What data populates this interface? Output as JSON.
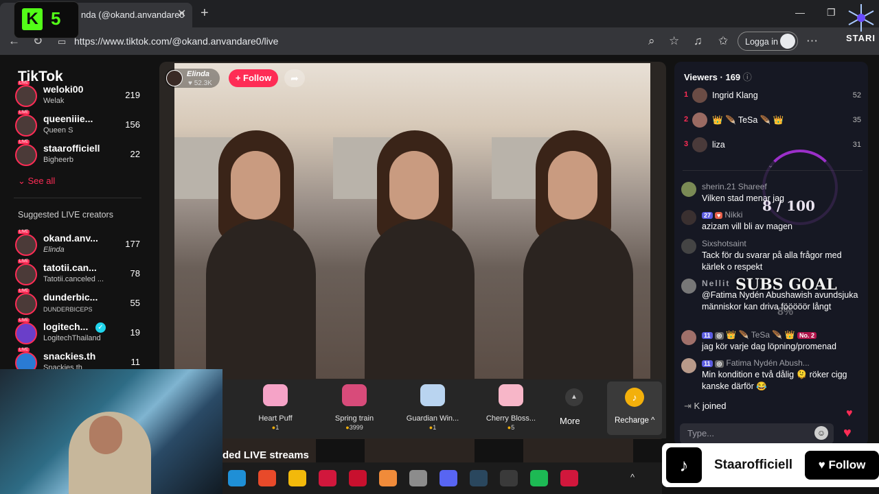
{
  "browser": {
    "tab_title": "nda (@okand.anvandare0",
    "tab_close": "✕",
    "new_tab": "+",
    "url": "https://www.tiktok.com/@okand.anvandare0/live",
    "login_label": "Logga in",
    "window_min": "—",
    "window_max": "❐",
    "window_close": "✕"
  },
  "kick_overlay": {
    "letter": "K",
    "count": "5",
    "accent": "#53fc18"
  },
  "stari_overlay": {
    "label": "STARI"
  },
  "sidebar": {
    "logo": "TikTok",
    "following": [
      {
        "name": "weloki00",
        "sub": "Welak",
        "count": "219"
      },
      {
        "name": "queeniiie...",
        "sub": "Queen S",
        "count": "156"
      },
      {
        "name": "staarofficiell",
        "sub": "Bigheerb",
        "count": "22"
      }
    ],
    "see_all": "See all",
    "suggested_title": "Suggested LIVE creators",
    "suggested": [
      {
        "name": "okand.anv...",
        "sub": "Elinda",
        "count": "177"
      },
      {
        "name": "tatotii.can...",
        "sub": "Tatotii.canceled ...",
        "count": "78"
      },
      {
        "name": "dunderbic...",
        "sub": "DUNDERBICEPS",
        "count": "55"
      },
      {
        "name": "logitech...",
        "sub": "LogitechThailand",
        "count": "19"
      },
      {
        "name": "snackies.th",
        "sub": "Snackies.th",
        "count": "11"
      }
    ],
    "live_tag": "LIVE"
  },
  "stream": {
    "host_name": "Elinda",
    "host_likes": "52.3K",
    "follow_label": "+ Follow",
    "gifts": [
      {
        "name": "Heart Puff",
        "price": "1",
        "color": "#f5a3c7"
      },
      {
        "name": "Spring train",
        "price": "3999",
        "color": "#d84b7a"
      },
      {
        "name": "Guardian Win...",
        "price": "1",
        "color": "#b9d4f0"
      },
      {
        "name": "Cherry Bloss...",
        "price": "5",
        "color": "#f7b6c8"
      }
    ],
    "more_label": "More",
    "recharge_label": "Recharge ^",
    "recommended_title": "ded LIVE streams"
  },
  "viewers": {
    "title": "Viewers · 169",
    "list": [
      {
        "rank": "1",
        "name": "Ingrid Klang",
        "count": "52"
      },
      {
        "rank": "2",
        "name": "👑 🪶 TeSa 🪶 👑",
        "count": "35"
      },
      {
        "rank": "3",
        "name": "liza",
        "count": "31"
      }
    ]
  },
  "chat": {
    "messages": [
      {
        "user": "sherin.21 Shareef",
        "text": "Vilken stad menar jag",
        "badges": []
      },
      {
        "user": "Nikki",
        "text": "azizam vill bli av magen",
        "badges": [
          "27"
        ]
      },
      {
        "user": "Sixshotsaint",
        "text": "Tack för du svarar på alla frågor med kärlek o respekt",
        "badges": []
      },
      {
        "user": "Nellit",
        "text": "@Fatima Nydén Abushawish avundsjuka människor kan driva fööööör långt",
        "badges": []
      },
      {
        "user": "👑 🪶 TeSa 🪶 👑",
        "text": "jag kör varje dag löpning/promenad",
        "badges": [
          "11",
          "No. 2"
        ]
      },
      {
        "user": "Fatima Nydén Abush...",
        "text": "Min kondition e två dålig 🫠 röker cigg kanske därför 😂",
        "badges": [
          "11"
        ]
      }
    ],
    "joined_user": "K",
    "joined_text": "joined",
    "input_placeholder": "Type..."
  },
  "subs_goal": {
    "count": "8 / 100",
    "label": "SUBS GOAL",
    "percent": "8%",
    "progress": 0.08
  },
  "follow_overlay": {
    "name": "Staarofficiell",
    "button": "Follow"
  },
  "taskbar": {
    "icons": [
      {
        "name": "edge",
        "color": "#1f8fd6"
      },
      {
        "name": "app-red",
        "color": "#e84a2a"
      },
      {
        "name": "chrome",
        "color": "#f2b90b"
      },
      {
        "name": "app-a",
        "color": "#d1173c"
      },
      {
        "name": "mcafee",
        "color": "#c8102e"
      },
      {
        "name": "app-spiral",
        "color": "#f08b3a"
      },
      {
        "name": "app-camera",
        "color": "#8c8c8c"
      },
      {
        "name": "discord",
        "color": "#5865f2"
      },
      {
        "name": "steam",
        "color": "#2a475e"
      },
      {
        "name": "tf",
        "color": "#3a3a3a"
      },
      {
        "name": "spotify",
        "color": "#1db954"
      },
      {
        "name": "tiktok",
        "color": "#d1173c"
      }
    ],
    "tray_chevron": "^"
  },
  "colors": {
    "accent": "#fe2c55",
    "panel": "#161823"
  }
}
